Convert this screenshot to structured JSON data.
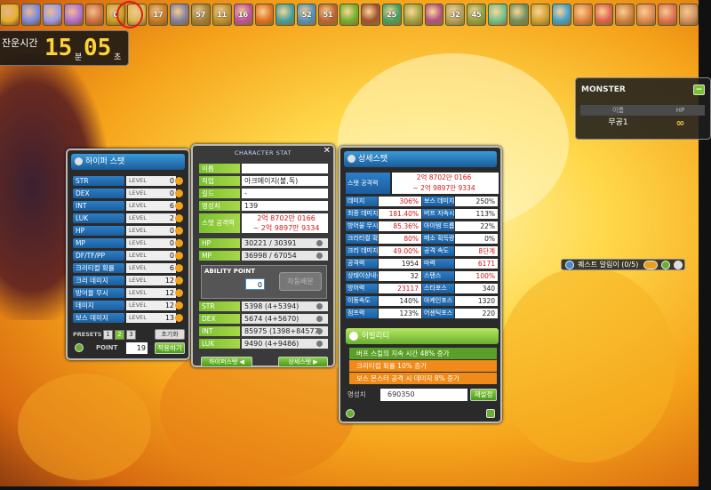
{
  "buffs": [
    {
      "label": "",
      "color": "#e8b028"
    },
    {
      "label": "",
      "color": "#7a8ae0"
    },
    {
      "label": "",
      "color": "#9a9ae8"
    },
    {
      "label": "",
      "color": "#b070d0"
    },
    {
      "label": "",
      "color": "#d07040"
    },
    {
      "label": "0",
      "color": "#c8a020"
    },
    {
      "label": "",
      "color": "#d8b850"
    },
    {
      "label": "17",
      "color": "#c87a20"
    },
    {
      "label": "",
      "color": "#8080a0"
    },
    {
      "label": "57",
      "color": "#a0803a"
    },
    {
      "label": "11",
      "color": "#c09030"
    },
    {
      "label": "16",
      "color": "#c050a0"
    },
    {
      "label": "",
      "color": "#e07020"
    },
    {
      "label": "",
      "color": "#40a0a0"
    },
    {
      "label": "52",
      "color": "#5090c0"
    },
    {
      "label": "51",
      "color": "#c06030"
    },
    {
      "label": "",
      "color": "#70b030"
    },
    {
      "label": "",
      "color": "#a05030"
    },
    {
      "label": "25",
      "color": "#40a060"
    },
    {
      "label": "",
      "color": "#a0a040"
    },
    {
      "label": "",
      "color": "#b05080"
    },
    {
      "label": "32",
      "color": "#b0a060"
    },
    {
      "label": "45",
      "color": "#90a040"
    },
    {
      "label": "",
      "color": "#70c090"
    },
    {
      "label": "",
      "color": "#709060"
    },
    {
      "label": "",
      "color": "#d0a030"
    },
    {
      "label": "",
      "color": "#40a0d0"
    },
    {
      "label": "",
      "color": "#e08040"
    },
    {
      "label": "",
      "color": "#e06050"
    },
    {
      "label": "",
      "color": "#d08040"
    },
    {
      "label": "",
      "color": "#e08850"
    },
    {
      "label": "",
      "color": "#e07050"
    },
    {
      "label": "",
      "color": "#d09060"
    }
  ],
  "timer": {
    "label": "잔운시간",
    "minutes": "15",
    "min_unit": "분",
    "seconds": "05",
    "sec_unit": "초"
  },
  "monster": {
    "title": "MONSTER",
    "min_btn": "−",
    "col_name": "이름",
    "col_hp": "HP",
    "name": "무공1",
    "hp": "∞"
  },
  "quest": {
    "text": "퀘스트 알림이 (0/5)"
  },
  "hyper_stat": {
    "title": "하이퍼 스탯",
    "level_word": "LEVEL",
    "rows": [
      {
        "name": "STR",
        "value": "0"
      },
      {
        "name": "DEX",
        "value": "0"
      },
      {
        "name": "INT",
        "value": "6"
      },
      {
        "name": "LUK",
        "value": "2"
      },
      {
        "name": "HP",
        "value": "0"
      },
      {
        "name": "MP",
        "value": "0"
      },
      {
        "name": "DF/TF/PP",
        "value": "0"
      },
      {
        "name": "크리티컬 확률",
        "value": "6"
      },
      {
        "name": "크리 데미지",
        "value": "12"
      },
      {
        "name": "방어율 무시",
        "value": "12"
      },
      {
        "name": "데미지",
        "value": "12"
      },
      {
        "name": "보스 데미지",
        "value": "13"
      }
    ],
    "preset_label": "PRESETS",
    "presets": [
      "1",
      "2",
      "3"
    ],
    "reset_label": "초기화",
    "point_label": "POINT",
    "point_value": "19",
    "apply_label": "적용하기"
  },
  "character_stat": {
    "title": "CHARACTER STAT",
    "close": "✕",
    "rows": [
      {
        "name": "이름",
        "value": ""
      },
      {
        "name": "직업",
        "value": "아크메이지(불,독)"
      },
      {
        "name": "길드",
        "value": "-"
      },
      {
        "name": "명성치",
        "value": "139"
      }
    ],
    "attack_name": "스탯 공격력",
    "attack_line1": "2억 8702만 0166",
    "attack_line2": "~ 2억 9897만 9334",
    "hpmp": [
      {
        "name": "HP",
        "value": "30221 / 30391"
      },
      {
        "name": "MP",
        "value": "36998 / 67054"
      }
    ],
    "ap_title": "ABILITY POINT",
    "ap_value": "0",
    "auto_label": "자동배분",
    "stats": [
      {
        "name": "STR",
        "value": "5398 (4+5394)"
      },
      {
        "name": "DEX",
        "value": "5674 (4+5670)"
      },
      {
        "name": "INT",
        "value": "85975 (1398+84577)"
      },
      {
        "name": "LUK",
        "value": "9490 (4+9486)"
      }
    ],
    "hyper_btn": "하이퍼스탯 ◀",
    "detail_btn": "상세스탯 ▶"
  },
  "detail_stat": {
    "title": "상세스탯",
    "attack_name": "스탯 공격력",
    "attack_line1": "2억 8702만 0166",
    "attack_line2": "~ 2억 9897만 9334",
    "rows": [
      [
        {
          "name": "데미지",
          "value": "306%",
          "red": true
        },
        {
          "name": "보스 데미지",
          "value": "250%",
          "red": false
        }
      ],
      [
        {
          "name": "최종 데미지",
          "value": "181.40%",
          "red": true
        },
        {
          "name": "버프 지속시간",
          "value": "113%",
          "red": false
        }
      ],
      [
        {
          "name": "방어율 무시",
          "value": "85.36%",
          "red": true
        },
        {
          "name": "아이템 드롭률",
          "value": "22%",
          "red": false
        }
      ],
      [
        {
          "name": "크리티컬 확률",
          "value": "80%",
          "red": true
        },
        {
          "name": "메소 획득량",
          "value": "0%",
          "red": false
        }
      ],
      [
        {
          "name": "크리 데미지",
          "value": "49.00%",
          "red": true
        },
        {
          "name": "공격 속도",
          "value": "8단계",
          "red": true
        }
      ],
      [
        {
          "name": "공격력",
          "value": "1954",
          "red": false
        },
        {
          "name": "마력",
          "value": "6171",
          "red": true
        }
      ],
      [
        {
          "name": "상태이상내성",
          "value": "32",
          "red": false
        },
        {
          "name": "스탠스",
          "value": "100%",
          "red": true
        }
      ],
      [
        {
          "name": "방어력",
          "value": "23117",
          "red": true
        },
        {
          "name": "스타포스",
          "value": "340",
          "red": false
        }
      ],
      [
        {
          "name": "이동속도",
          "value": "140%",
          "red": false
        },
        {
          "name": "아케인포스",
          "value": "1320",
          "red": false
        }
      ],
      [
        {
          "name": "점프력",
          "value": "123%",
          "red": false
        },
        {
          "name": "어센틱포스",
          "value": "220",
          "red": false
        }
      ]
    ],
    "ability_title": "어빌리티",
    "abilities": [
      {
        "text": "버프 스킬의 지속 시간 48% 증가",
        "color": "#5aa028"
      },
      {
        "text": "크리티컬 확률 10% 증가",
        "color": "#f08a18"
      },
      {
        "text": "보스 몬스터 공격 시 데미지 8% 증가",
        "color": "#f08a18"
      }
    ],
    "honor_label": "명성치",
    "honor_value": "690350",
    "honor_btn": "재설정"
  }
}
